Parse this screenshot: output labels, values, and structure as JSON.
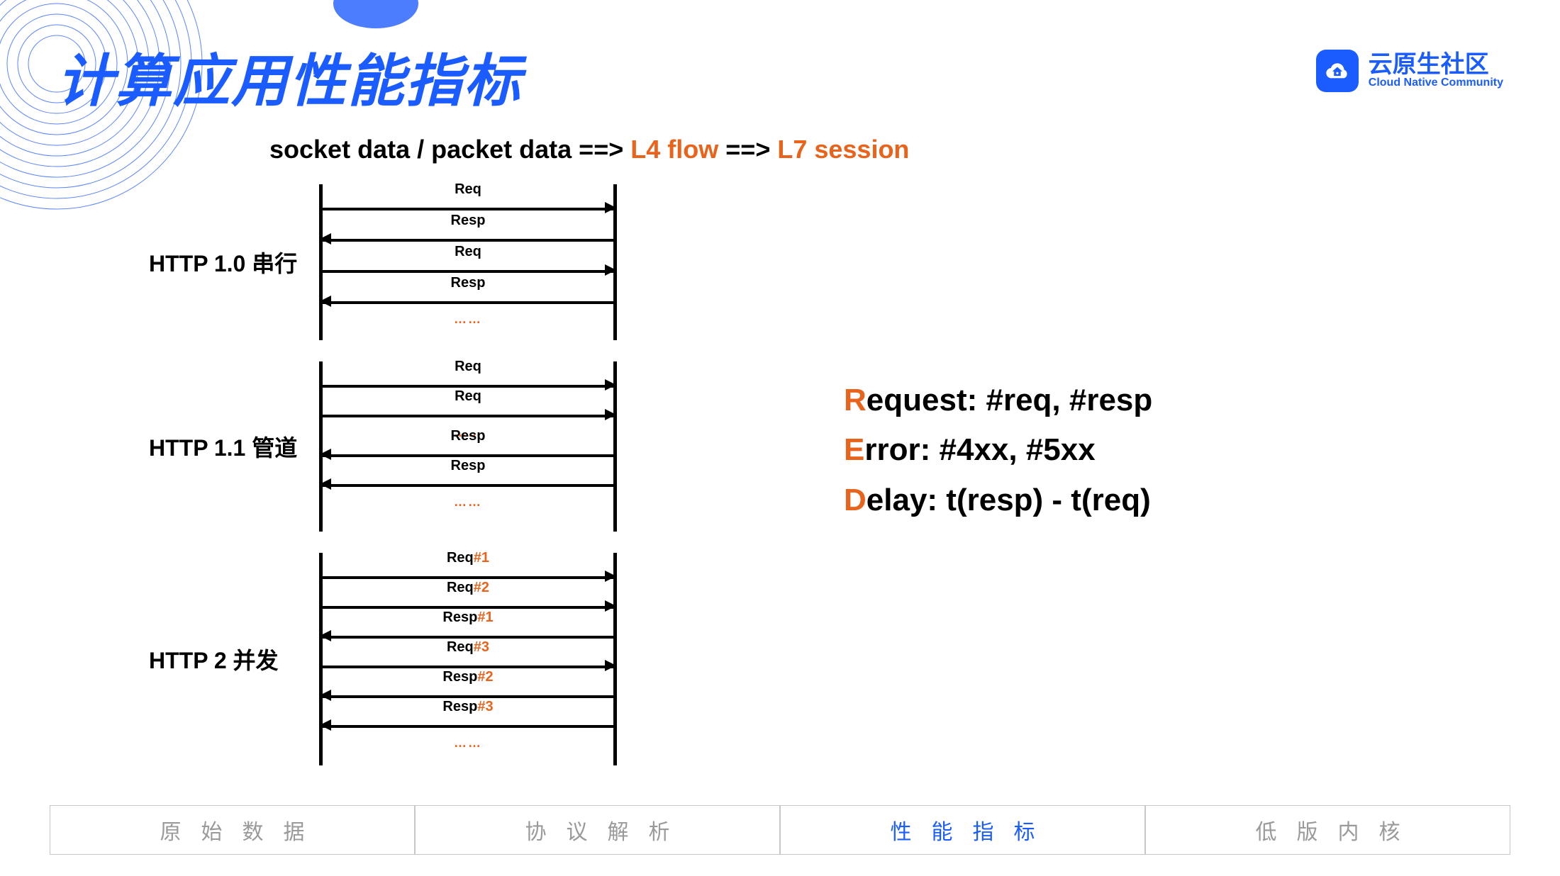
{
  "title": "计算应用性能指标",
  "logo": {
    "cn": "云原生社区",
    "en": "Cloud Native Community"
  },
  "pipeline": {
    "p1": "socket data / packet data ==> ",
    "h1": "L4 flow",
    "p2": " ==> ",
    "h2": "L7 session"
  },
  "sections": {
    "http10": "HTTP 1.0 串行",
    "http11": "HTTP 1.1 管道",
    "http2": "HTTP 2 并发"
  },
  "msgs": {
    "req": "Req",
    "resp": "Resp",
    "req1a": "Req",
    "req1b": "#1",
    "req2a": "Req",
    "req2b": "#2",
    "resp1a": "Resp",
    "resp1b": "#1",
    "req3a": "Req",
    "req3b": "#3",
    "resp2a": "Resp",
    "resp2b": "#2",
    "resp3a": "Resp",
    "resp3b": "#3",
    "dots": "……"
  },
  "red": {
    "r1a": "R",
    "r1b": "equest: #req, #resp",
    "r2a": "E",
    "r2b": "rror: #4xx, #5xx",
    "r3a": "D",
    "r3b": "elay: t(resp) - t(req)"
  },
  "tabs": {
    "t1": "原始数据",
    "t2": "协议解析",
    "t3": "性能指标",
    "t4": "低版内核"
  },
  "chart_data": {
    "type": "sequence-diagram-set",
    "pipeline": "socket data / packet data ==> L4 flow ==> L7 session",
    "metrics_formula": {
      "Request": "#req, #resp",
      "Error": "#4xx, #5xx",
      "Delay": "t(resp) - t(req)"
    },
    "diagrams": [
      {
        "name": "HTTP 1.0 串行",
        "messages": [
          {
            "dir": "right",
            "label": "Req"
          },
          {
            "dir": "left",
            "label": "Resp"
          },
          {
            "dir": "right",
            "label": "Req"
          },
          {
            "dir": "left",
            "label": "Resp"
          },
          {
            "continues": true
          }
        ]
      },
      {
        "name": "HTTP 1.1 管道",
        "messages": [
          {
            "dir": "right",
            "label": "Req"
          },
          {
            "dir": "right",
            "label": "Req"
          },
          {
            "continues": true
          },
          {
            "dir": "left",
            "label": "Resp"
          },
          {
            "dir": "left",
            "label": "Resp"
          },
          {
            "continues": true
          }
        ]
      },
      {
        "name": "HTTP 2 并发",
        "messages": [
          {
            "dir": "right",
            "label": "Req#1"
          },
          {
            "dir": "right",
            "label": "Req#2"
          },
          {
            "dir": "left",
            "label": "Resp#1"
          },
          {
            "dir": "right",
            "label": "Req#3"
          },
          {
            "dir": "left",
            "label": "Resp#2"
          },
          {
            "dir": "left",
            "label": "Resp#3"
          },
          {
            "continues": true
          }
        ]
      }
    ]
  }
}
